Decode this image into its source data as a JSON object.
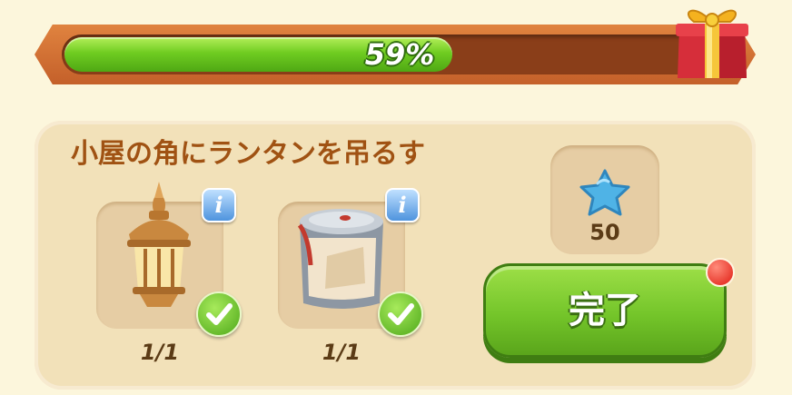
{
  "progress": {
    "value": 0.59,
    "label": "59%"
  },
  "task": {
    "title": "小屋の角にランタンを吊るす",
    "items": [
      {
        "name": "lantern",
        "count": "1/1",
        "done": true
      },
      {
        "name": "paint-can",
        "count": "1/1",
        "done": true
      }
    ]
  },
  "reward": {
    "icon": "blue-star-icon",
    "value": "50"
  },
  "complete_button": {
    "label": "完了"
  },
  "colors": {
    "accent_green": "#74c52a",
    "frame_orange": "#d87438",
    "panel": "#f2e1b9",
    "title_brown": "#a05213"
  }
}
